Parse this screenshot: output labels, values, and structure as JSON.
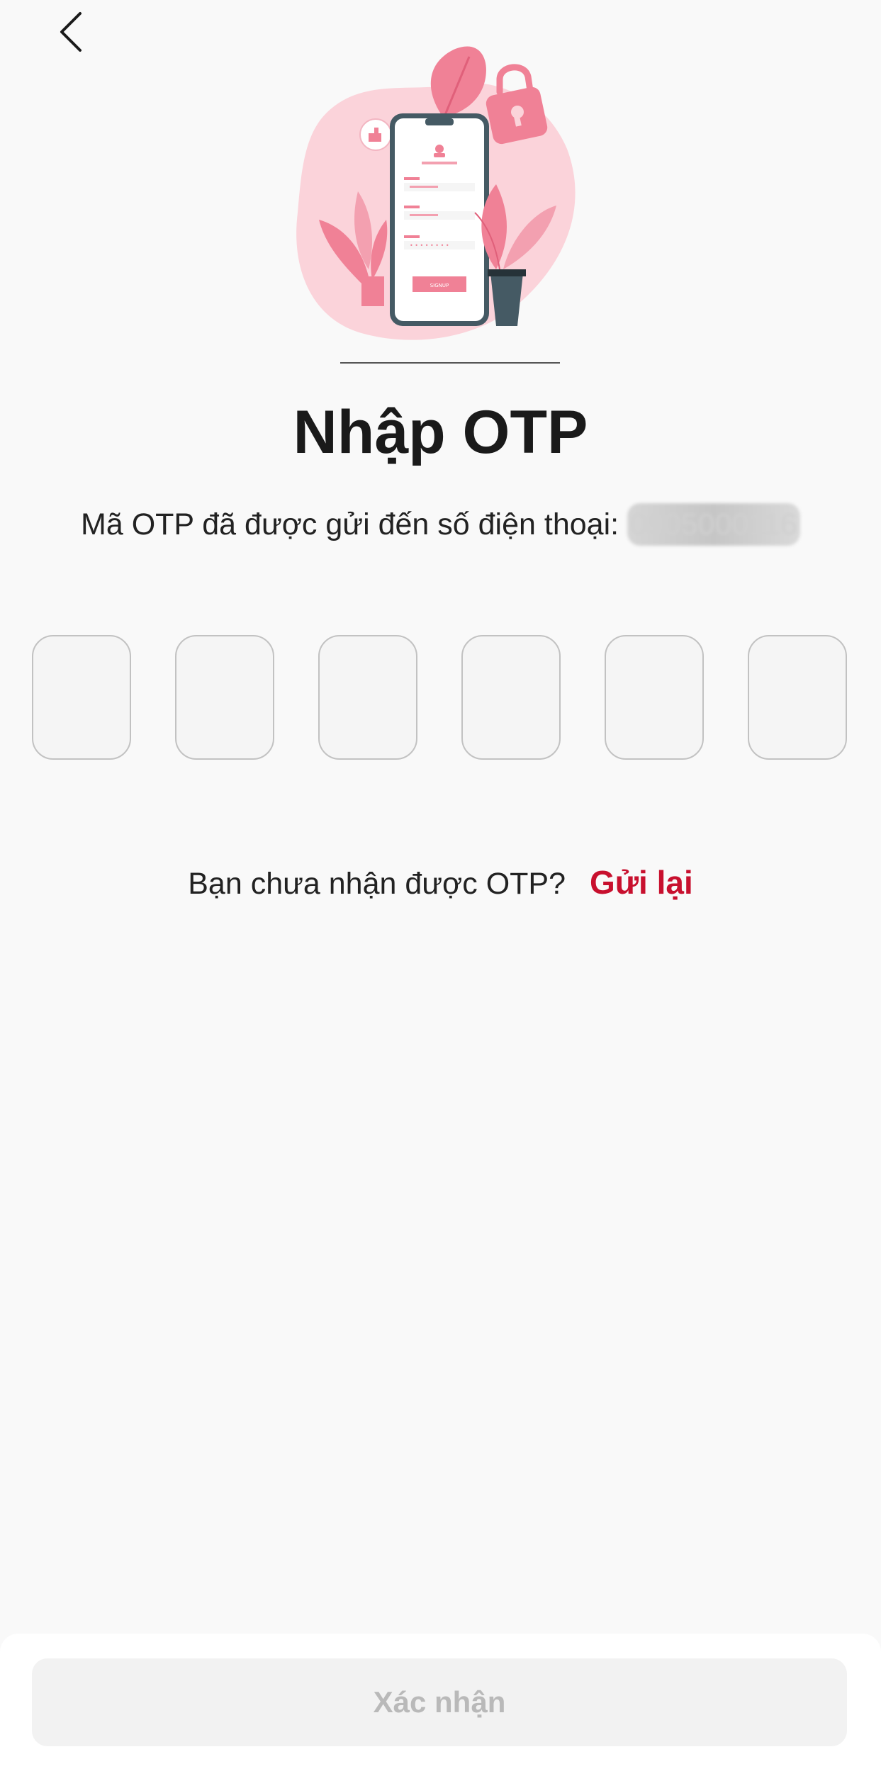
{
  "header": {
    "back_icon": "chevron-left-icon"
  },
  "illustration": {
    "name": "phone-signup-illustration",
    "button_label": "SIGNUP",
    "accent_color": "#f08196",
    "blob_color": "#fbd3da",
    "dark_color": "#455a64"
  },
  "main": {
    "title": "Nhập OTP",
    "subtitle_prefix": "Mã OTP đã được gửi đến số điện thoại: ",
    "phone_masked": "0905000116",
    "otp_digits": [
      "",
      "",
      "",
      "",
      "",
      ""
    ]
  },
  "resend": {
    "prompt": "Bạn chưa nhận được OTP?",
    "link_label": "Gửi lại",
    "link_color": "#c8102e"
  },
  "footer": {
    "confirm_label": "Xác nhận",
    "confirm_disabled": true
  }
}
